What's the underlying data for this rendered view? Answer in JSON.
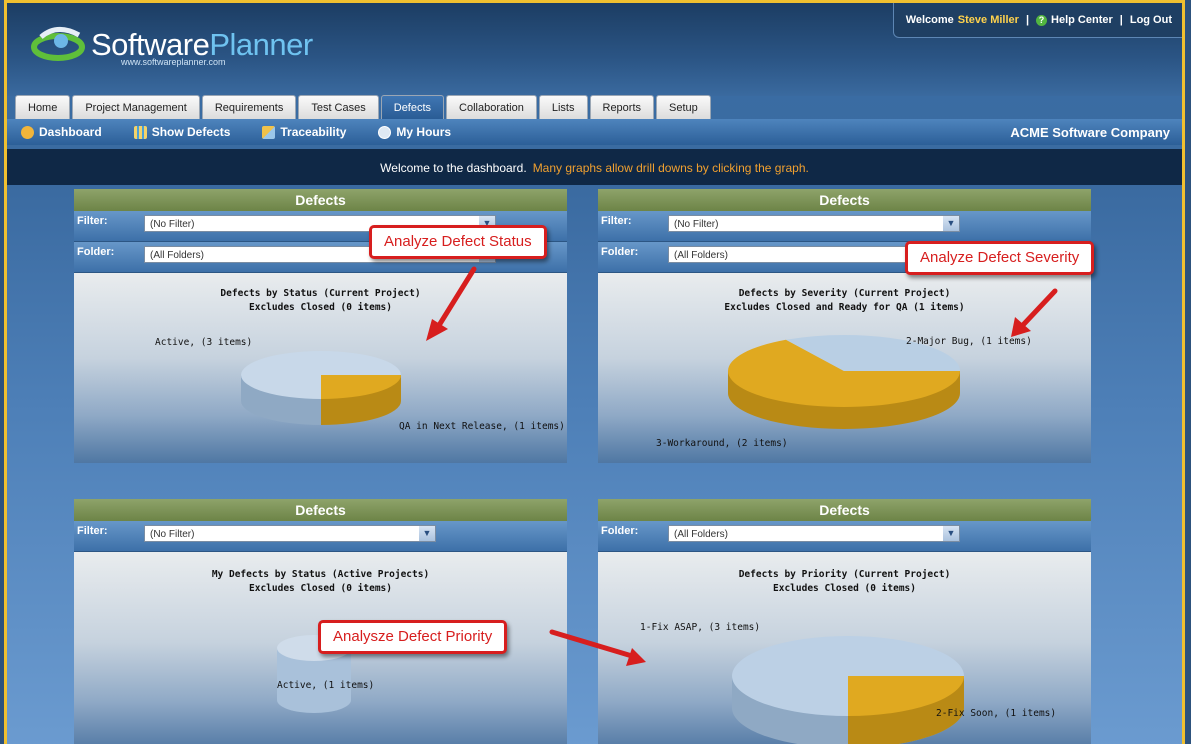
{
  "header": {
    "logo_text_a": "Software",
    "logo_text_b": "Planner",
    "logo_url": "www.softwareplanner.com",
    "welcome_prefix": "Welcome",
    "user": "Steve Miller",
    "help": "Help Center",
    "logout": "Log Out"
  },
  "tabs": [
    "Home",
    "Project Management",
    "Requirements",
    "Test Cases",
    "Defects",
    "Collaboration",
    "Lists",
    "Reports",
    "Setup"
  ],
  "active_tab": "Defects",
  "subnav": {
    "items": [
      {
        "label": "Dashboard",
        "icon": "dashboard-icon"
      },
      {
        "label": "Show Defects",
        "icon": "grid-icon"
      },
      {
        "label": "Traceability",
        "icon": "traceability-icon"
      },
      {
        "label": "My Hours",
        "icon": "clock-icon"
      }
    ],
    "company": "ACME Software Company"
  },
  "welcome": {
    "text": "Welcome to the dashboard.",
    "hint": "Many graphs allow drill downs by clicking the graph."
  },
  "panels": [
    {
      "header": "Defects",
      "filters": [
        {
          "label": "Filter:",
          "value": "(No Filter)"
        },
        {
          "label": "Folder:",
          "value": "(All Folders)"
        }
      ],
      "title1": "Defects by Status (Current Project)",
      "title2": "Excludes Closed (0 items)",
      "labels": [
        "Active, (3 items)",
        "QA in Next Release, (1 items)"
      ]
    },
    {
      "header": "Defects",
      "filters": [
        {
          "label": "Filter:",
          "value": "(No Filter)"
        },
        {
          "label": "Folder:",
          "value": "(All Folders)"
        }
      ],
      "title1": "Defects by Severity (Current Project)",
      "title2": "Excludes Closed and Ready for QA (1 items)",
      "labels": [
        "2-Major Bug, (1 items)",
        "3-Workaround, (2 items)"
      ]
    },
    {
      "header": "Defects",
      "filters": [
        {
          "label": "Filter:",
          "value": "(No Filter)"
        }
      ],
      "title1": "My Defects by Status (Active Projects)",
      "title2": "Excludes Closed (0 items)",
      "labels": [
        "Active, (1 items)"
      ]
    },
    {
      "header": "Defects",
      "filters": [
        {
          "label": "Folder:",
          "value": "(All Folders)"
        }
      ],
      "title1": "Defects by Priority (Current Project)",
      "title2": "Excludes Closed (0 items)",
      "labels": [
        "1-Fix ASAP, (3 items)",
        "2-Fix Soon, (1 items)"
      ]
    }
  ],
  "callouts": [
    "Analyze Defect Status",
    "Analyze Defect Severity",
    "Analysze Defect Priority"
  ],
  "colors": {
    "slice_blue": "#b9cfe4",
    "slice_gold": "#e0a920",
    "accent_red": "#d71e1e",
    "panel_header": "#7f9558"
  },
  "chart_data": [
    {
      "type": "pie",
      "title": "Defects by Status (Current Project)",
      "subtitle": "Excludes Closed (0 items)",
      "categories": [
        "Active",
        "QA in Next Release"
      ],
      "values": [
        3,
        1
      ]
    },
    {
      "type": "pie",
      "title": "Defects by Severity (Current Project)",
      "subtitle": "Excludes Closed and Ready for QA (1 items)",
      "categories": [
        "2-Major Bug",
        "3-Workaround"
      ],
      "values": [
        1,
        2
      ]
    },
    {
      "type": "pie",
      "title": "My Defects by Status (Active Projects)",
      "subtitle": "Excludes Closed (0 items)",
      "categories": [
        "Active"
      ],
      "values": [
        1
      ]
    },
    {
      "type": "pie",
      "title": "Defects by Priority (Current Project)",
      "subtitle": "Excludes Closed (0 items)",
      "categories": [
        "1-Fix ASAP",
        "2-Fix Soon"
      ],
      "values": [
        3,
        1
      ]
    }
  ]
}
